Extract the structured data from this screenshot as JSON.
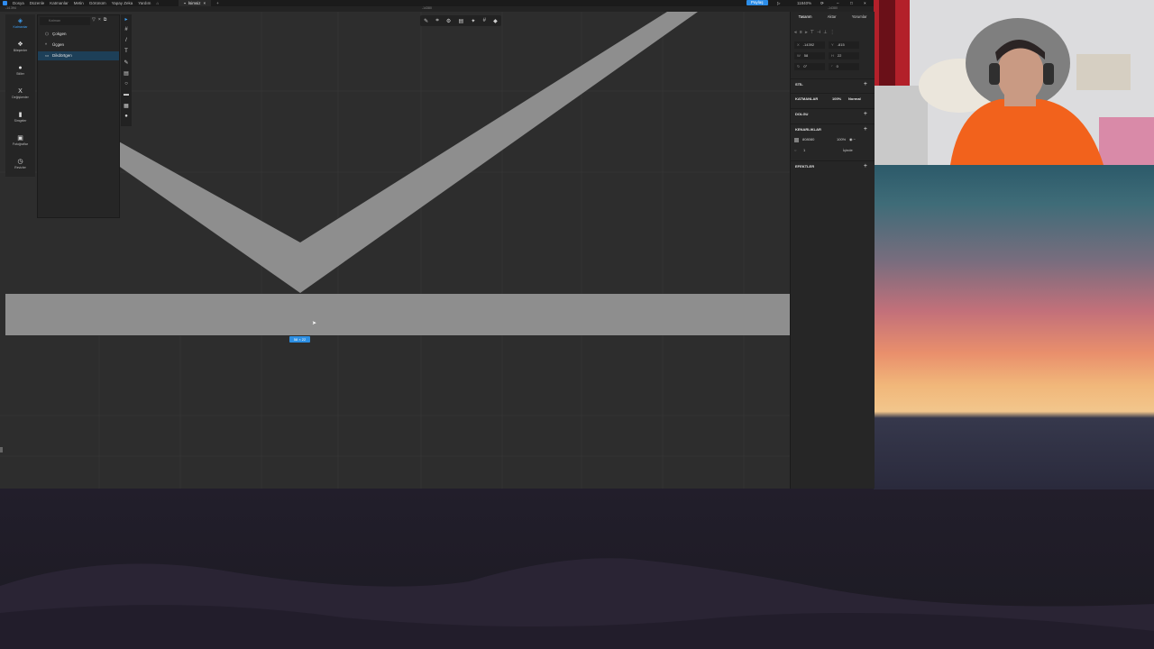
{
  "menubar": {
    "items": [
      "Dosya",
      "Düzenle",
      "Katmanlar",
      "Metin",
      "Görünüm",
      "Yapay Zeka",
      "Yardım"
    ],
    "doc_tab": "İsimsiz",
    "share_label": "Paylaş",
    "zoom": "11840%",
    "coords": "1424"
  },
  "ruler": {
    "top_left": "-14.394",
    "top_center": "-14380",
    "top_right": "-14380"
  },
  "left_rail": [
    {
      "icon": "layers-icon",
      "label": "Katmanlar",
      "active": true
    },
    {
      "icon": "components-icon",
      "label": "Bileşenler",
      "active": false
    },
    {
      "icon": "styles-icon",
      "label": "Stiller",
      "active": false
    },
    {
      "icon": "variables-icon",
      "label": "Değişkenler",
      "active": false
    },
    {
      "icon": "symbols-icon",
      "label": "Simgeler",
      "active": false
    },
    {
      "icon": "images-icon",
      "label": "Fotoğraflar",
      "active": false
    },
    {
      "icon": "history-icon",
      "label": "Revizler",
      "active": false
    }
  ],
  "layers_panel": {
    "search_placeholder": "Katman",
    "layers": [
      {
        "name": "Çokgen",
        "icon": "polygon-icon",
        "selected": false
      },
      {
        "name": "Üçgen",
        "icon": "triangle-icon",
        "selected": false
      },
      {
        "name": "Dikdörtgen",
        "icon": "rectangle-icon",
        "selected": true
      }
    ]
  },
  "selection": {
    "size_label": "58 × 22"
  },
  "right_panel": {
    "tabs": [
      "Tasarım",
      "Aktar",
      "Yorumlar"
    ],
    "x": "-14392",
    "y": "-815",
    "w": "58",
    "h": "22",
    "rotation": "0°",
    "radius": "0",
    "sections": {
      "style": "STİL",
      "layers": "KATMANLAR",
      "layer_opacity": "100%",
      "blend": "Normal",
      "fill": "DOLGU",
      "stroke": "KENARLIKLAR",
      "stroke_color": "808080",
      "stroke_opacity": "100%",
      "stroke_width": "1",
      "stroke_position": "İçinde",
      "effects": "EFEKTLER"
    }
  },
  "colors": {
    "shape_fill": "#8e8e8e",
    "accent": "#2d8fe3",
    "canvas_bg": "#2d2d2d"
  }
}
